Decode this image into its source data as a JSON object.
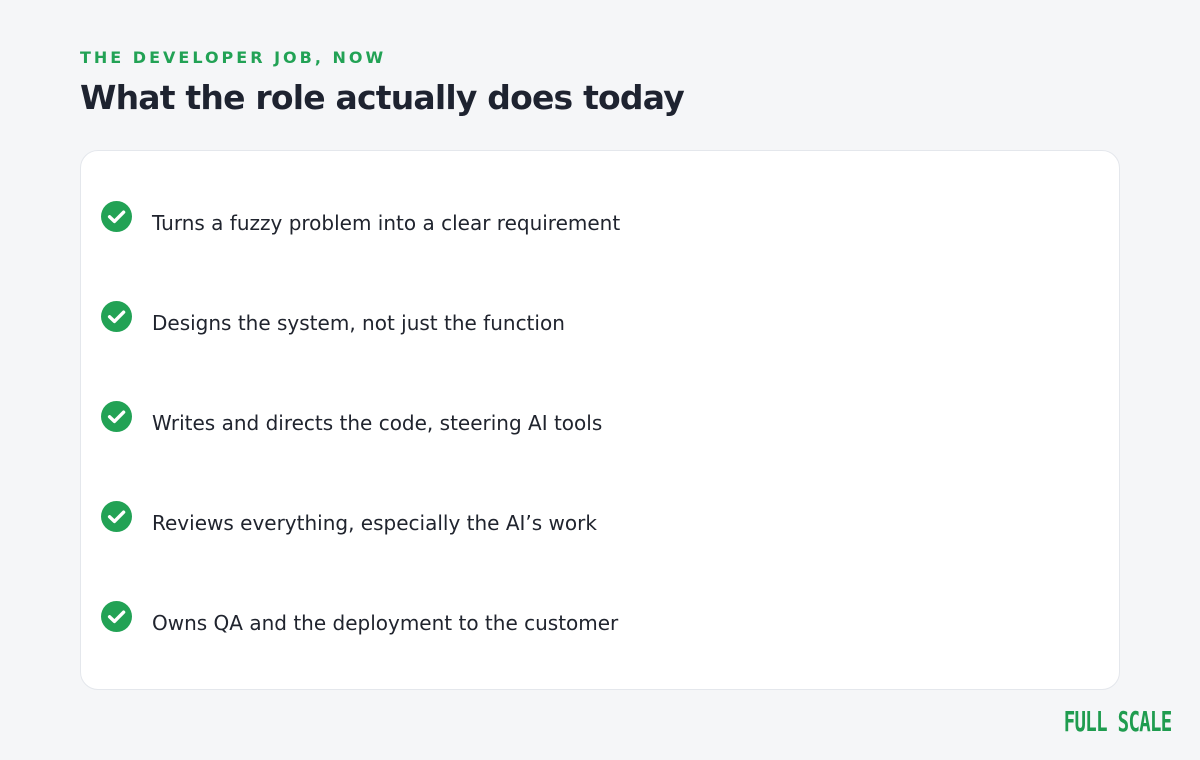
{
  "header": {
    "eyebrow": "THE DEVELOPER JOB, NOW",
    "title": "What the role actually does today"
  },
  "checklist": {
    "icon": "check-circle-icon",
    "items": [
      "Turns a fuzzy problem into a clear requirement",
      "Designs the system, not just the function",
      "Writes and directs the code, steering AI tools",
      "Reviews everything, especially the AI’s work",
      "Owns QA and the deployment to the customer"
    ]
  },
  "brand": {
    "logo_text": "FULL SCALE"
  },
  "colors": {
    "accent": "#22a255",
    "background": "#f5f6f8",
    "card": "#ffffff",
    "text": "#1e2330"
  }
}
